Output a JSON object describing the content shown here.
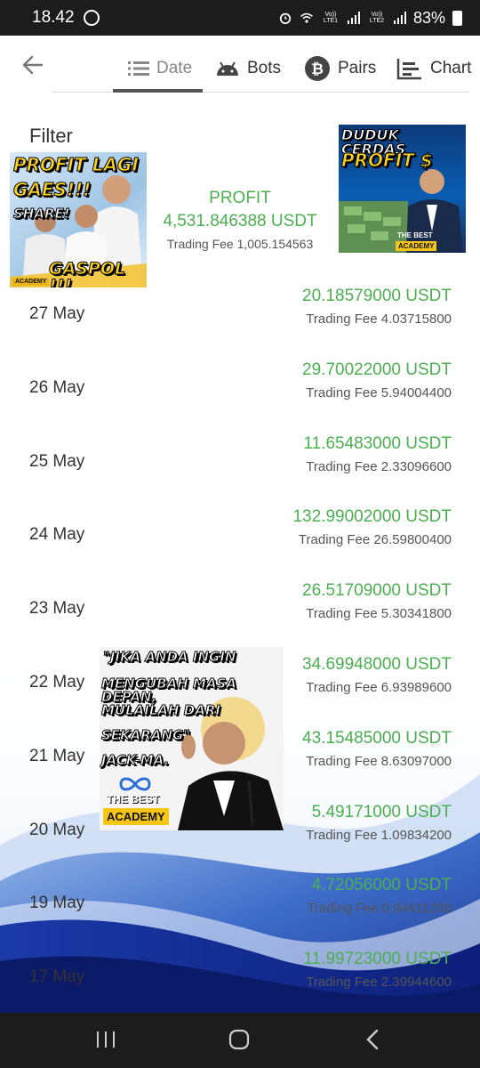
{
  "status_bar": {
    "time": "18.42",
    "battery": "83%",
    "lte1": "Vo)) LTE1",
    "lte2": "Vo)) LTE2"
  },
  "header": {
    "tabs": [
      {
        "label": "Date",
        "icon": "list-icon",
        "active": true
      },
      {
        "label": "Bots",
        "icon": "android-icon",
        "active": false
      },
      {
        "label": "Pairs",
        "icon": "bitcoin-icon",
        "active": false
      },
      {
        "label": "Chart",
        "icon": "chart-icon",
        "active": false
      }
    ]
  },
  "filter_label": "Filter",
  "summary": {
    "label": "PROFIT",
    "value": "4,531.846388 USDT",
    "fee": "Trading Fee 1,005.154563"
  },
  "rows": [
    {
      "date": "27 May",
      "amount": "20.18579000 USDT",
      "fee": "Trading Fee 4.03715800"
    },
    {
      "date": "26 May",
      "amount": "29.70022000 USDT",
      "fee": "Trading Fee 5.94004400"
    },
    {
      "date": "25 May",
      "amount": "11.65483000 USDT",
      "fee": "Trading Fee 2.33096600"
    },
    {
      "date": "24 May",
      "amount": "132.99002000 USDT",
      "fee": "Trading Fee 26.59800400"
    },
    {
      "date": "23 May",
      "amount": "26.51709000 USDT",
      "fee": "Trading Fee 5.30341800"
    },
    {
      "date": "22 May",
      "amount": "34.69948000 USDT",
      "fee": "Trading Fee 6.93989600"
    },
    {
      "date": "21 May",
      "amount": "43.15485000 USDT",
      "fee": "Trading Fee 8.63097000"
    },
    {
      "date": "20 May",
      "amount": "5.49171000 USDT",
      "fee": "Trading Fee 1.09834200"
    },
    {
      "date": "19 May",
      "amount": "4.72056000 USDT",
      "fee": "Trading Fee 0.94411200"
    },
    {
      "date": "17 May",
      "amount": "11.99723000 USDT",
      "fee": "Trading Fee 2.39944600"
    }
  ],
  "promo_left": {
    "line1": "PROFIT LAGI",
    "line2": "GAES!!!",
    "line3": "SHARE!",
    "line4": "GASPOL !!!",
    "badge": "ACADEMY"
  },
  "promo_right": {
    "line1": "DUDUK CERDAS",
    "line2": "PROFIT $",
    "badge_top": "THE BEST",
    "badge": "ACADEMY"
  },
  "promo_quote": {
    "line1": "\"JIKA ANDA INGIN",
    "line2": "MENGUBAH MASA DEPAN,",
    "line3": "MULAILAH DARI",
    "line4": "SEKARANG\"",
    "line5": "JACK-MA.",
    "badge_top": "THE BEST",
    "badge": "ACADEMY"
  },
  "colors": {
    "profit_green": "#4caf50",
    "status_bar": "#1c1c1c",
    "badge_yellow": "#f5c518"
  }
}
